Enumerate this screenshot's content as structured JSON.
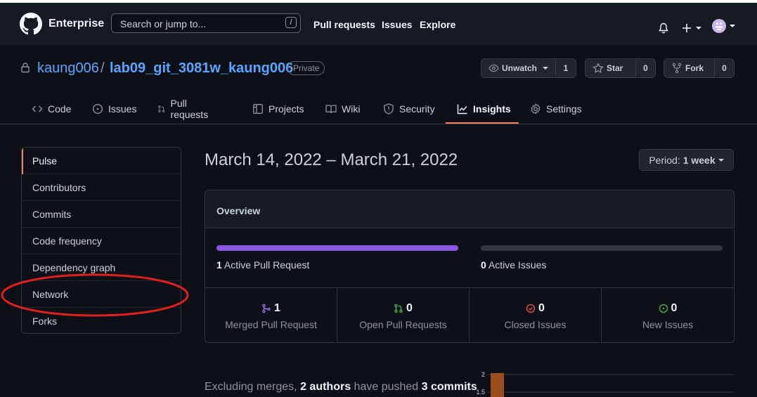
{
  "header": {
    "brand": "Enterprise",
    "search_placeholder": "Search or jump to...",
    "search_shortcut": "/",
    "nav": [
      "Pull requests",
      "Issues",
      "Explore"
    ]
  },
  "repo": {
    "owner": "kaung006",
    "separator": "/",
    "name": "lab09_git_3081w_kaung006",
    "visibility": "Private",
    "watch": {
      "label": "Unwatch",
      "count": "1"
    },
    "star": {
      "label": "Star",
      "count": "0"
    },
    "fork": {
      "label": "Fork",
      "count": "0"
    }
  },
  "tabs": [
    {
      "label": "Code",
      "icon": "code-icon"
    },
    {
      "label": "Issues",
      "icon": "issue-opened-icon"
    },
    {
      "label": "Pull requests",
      "icon": "git-pull-request-icon"
    },
    {
      "label": "Projects",
      "icon": "table-icon"
    },
    {
      "label": "Wiki",
      "icon": "book-icon"
    },
    {
      "label": "Security",
      "icon": "shield-icon"
    },
    {
      "label": "Insights",
      "icon": "graph-icon",
      "selected": true
    },
    {
      "label": "Settings",
      "icon": "gear-icon"
    }
  ],
  "sidebar": {
    "items": [
      {
        "label": "Pulse",
        "selected": true
      },
      {
        "label": "Contributors"
      },
      {
        "label": "Commits"
      },
      {
        "label": "Code frequency"
      },
      {
        "label": "Dependency graph"
      },
      {
        "label": "Network"
      },
      {
        "label": "Forks"
      }
    ]
  },
  "pulse": {
    "date_range": "March 14, 2022 – March 21, 2022",
    "period_label": "Period:",
    "period_value": "1 week",
    "overview_title": "Overview",
    "active_pull_requests": {
      "count": "1",
      "label": "Active Pull Request",
      "fill": 1.0
    },
    "active_issues": {
      "count": "0",
      "label": "Active Issues",
      "fill": 0.0
    },
    "stats": [
      {
        "count": "1",
        "label": "Merged Pull Request",
        "icon": "git-merge-icon",
        "color": "#a371f7"
      },
      {
        "count": "0",
        "label": "Open Pull Requests",
        "icon": "git-pull-request-icon",
        "color": "#3fb950"
      },
      {
        "count": "0",
        "label": "Closed Issues",
        "icon": "issue-closed-icon",
        "color": "#f85149"
      },
      {
        "count": "0",
        "label": "New Issues",
        "icon": "issue-opened-icon",
        "color": "#3fb950"
      }
    ],
    "summary": {
      "prefix": "Excluding merges,",
      "authors": "2 authors",
      "middle": "have pushed",
      "commits": "3 commits"
    },
    "commit_chart_ticks": [
      "2",
      "1.5"
    ]
  },
  "colors": {
    "accent_underline": "#f78166",
    "progress_fill": "#8957e5",
    "annotation": "#e0201f",
    "chart_bar": "#9a4e1d"
  }
}
